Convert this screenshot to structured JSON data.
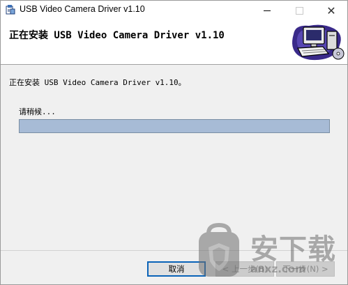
{
  "window": {
    "title": "USB Video Camera Driver v1.10",
    "icon": "installer-app-icon",
    "controls": {
      "minimize": "minimize-icon",
      "maximize": "maximize-icon",
      "close_glyph": "✕"
    }
  },
  "banner": {
    "title": "正在安装 USB Video Camera Driver v1.10",
    "graphic": "computer-install-graphic"
  },
  "body": {
    "status": "正在安装 USB Video Camera Driver v1.10。",
    "wait_label": "请稍候...",
    "progress": {
      "value": 1.0
    }
  },
  "footer": {
    "cancel_label": "取消",
    "back_label": "< 上一步(B)",
    "next_label": "下一步(N) >"
  },
  "watermark": {
    "text": "安下载",
    "domain": "anxz.com"
  },
  "colors": {
    "progress_fill": "#a7bbd6",
    "progress_border": "#7a8ea3",
    "dialog_bg": "#f0f0f0",
    "focus_border": "#0a63b8"
  }
}
